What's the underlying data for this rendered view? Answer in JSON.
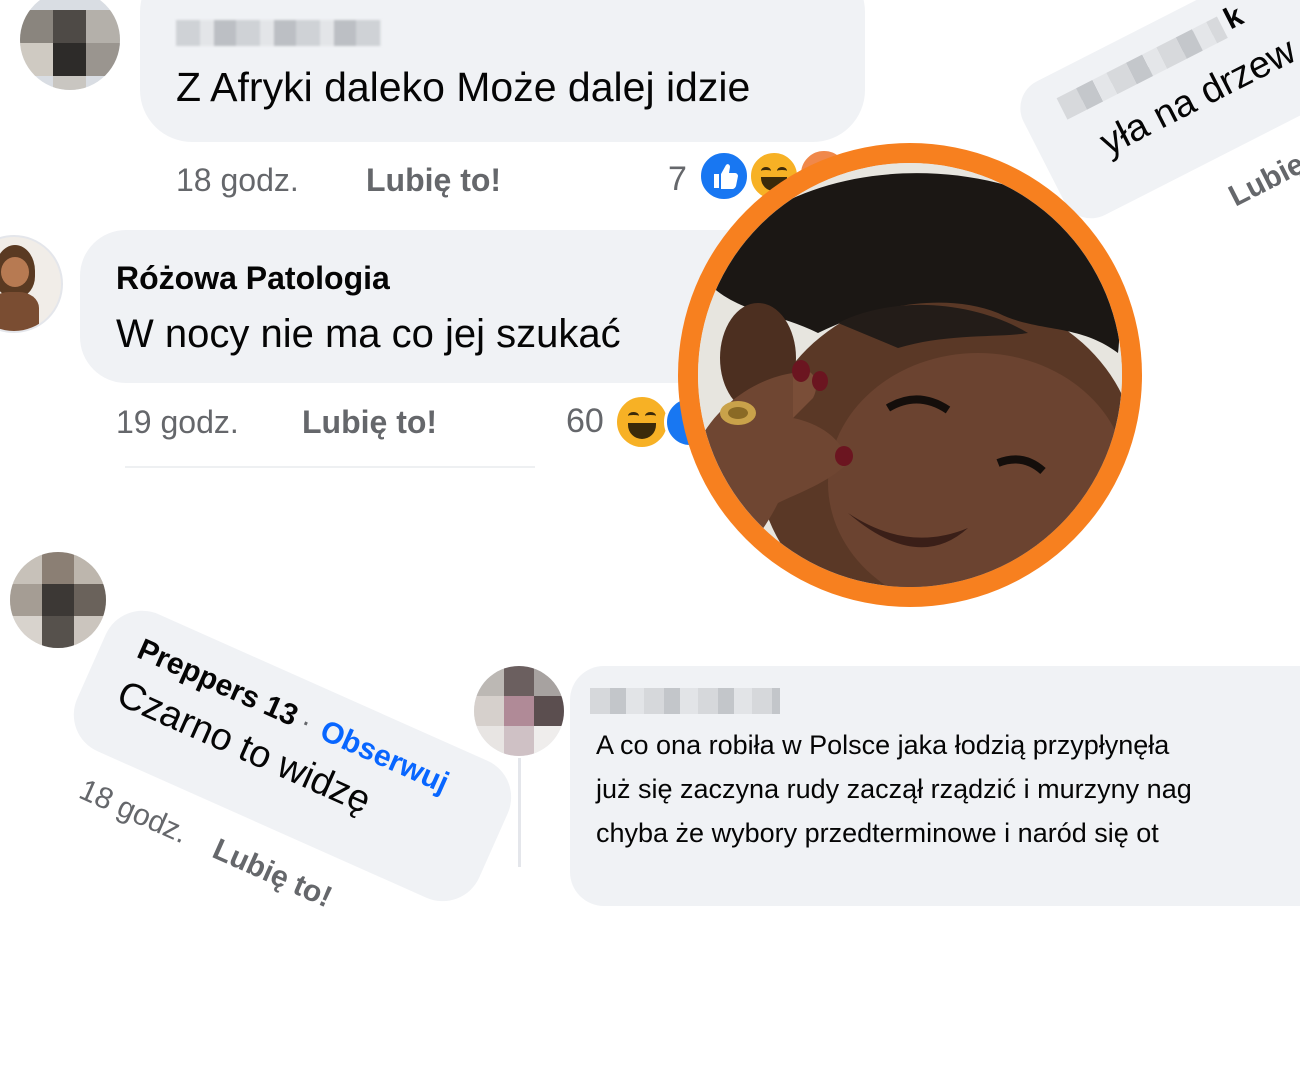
{
  "comments": [
    {
      "author": "",
      "text": "Z Afryki daleko Może dalej idzie",
      "time": "18 godz.",
      "like_label": "Lubię to!",
      "reaction_count": "7"
    },
    {
      "author": "Różowa Patologia",
      "text": "W nocy nie ma co jej szukać",
      "time": "19 godz.",
      "like_label": "Lubię to!",
      "reaction_count": "60"
    },
    {
      "author": "Preppers 13",
      "separator": "·",
      "follow_label": "Obserwuj",
      "text": "Czarno to widzę",
      "time": "18 godz.",
      "like_label": "Lubię to!"
    },
    {
      "author": "",
      "text_lines": [
        "A co ona robiła w Polsce jaka łodzią przypłynęła",
        "już się zaczyna rudy zaczął rządzić i murzyny nag",
        "chyba że wybory przedterminowe i naród się ot"
      ]
    },
    {
      "author_partial": "k",
      "text": "yła na drzew",
      "like_label": "Lubię to!"
    }
  ],
  "colors": {
    "bubble": "#f0f2f5",
    "meta_text": "#65676b",
    "link_blue": "#0866ff",
    "orange_ring": "#f7801f"
  }
}
